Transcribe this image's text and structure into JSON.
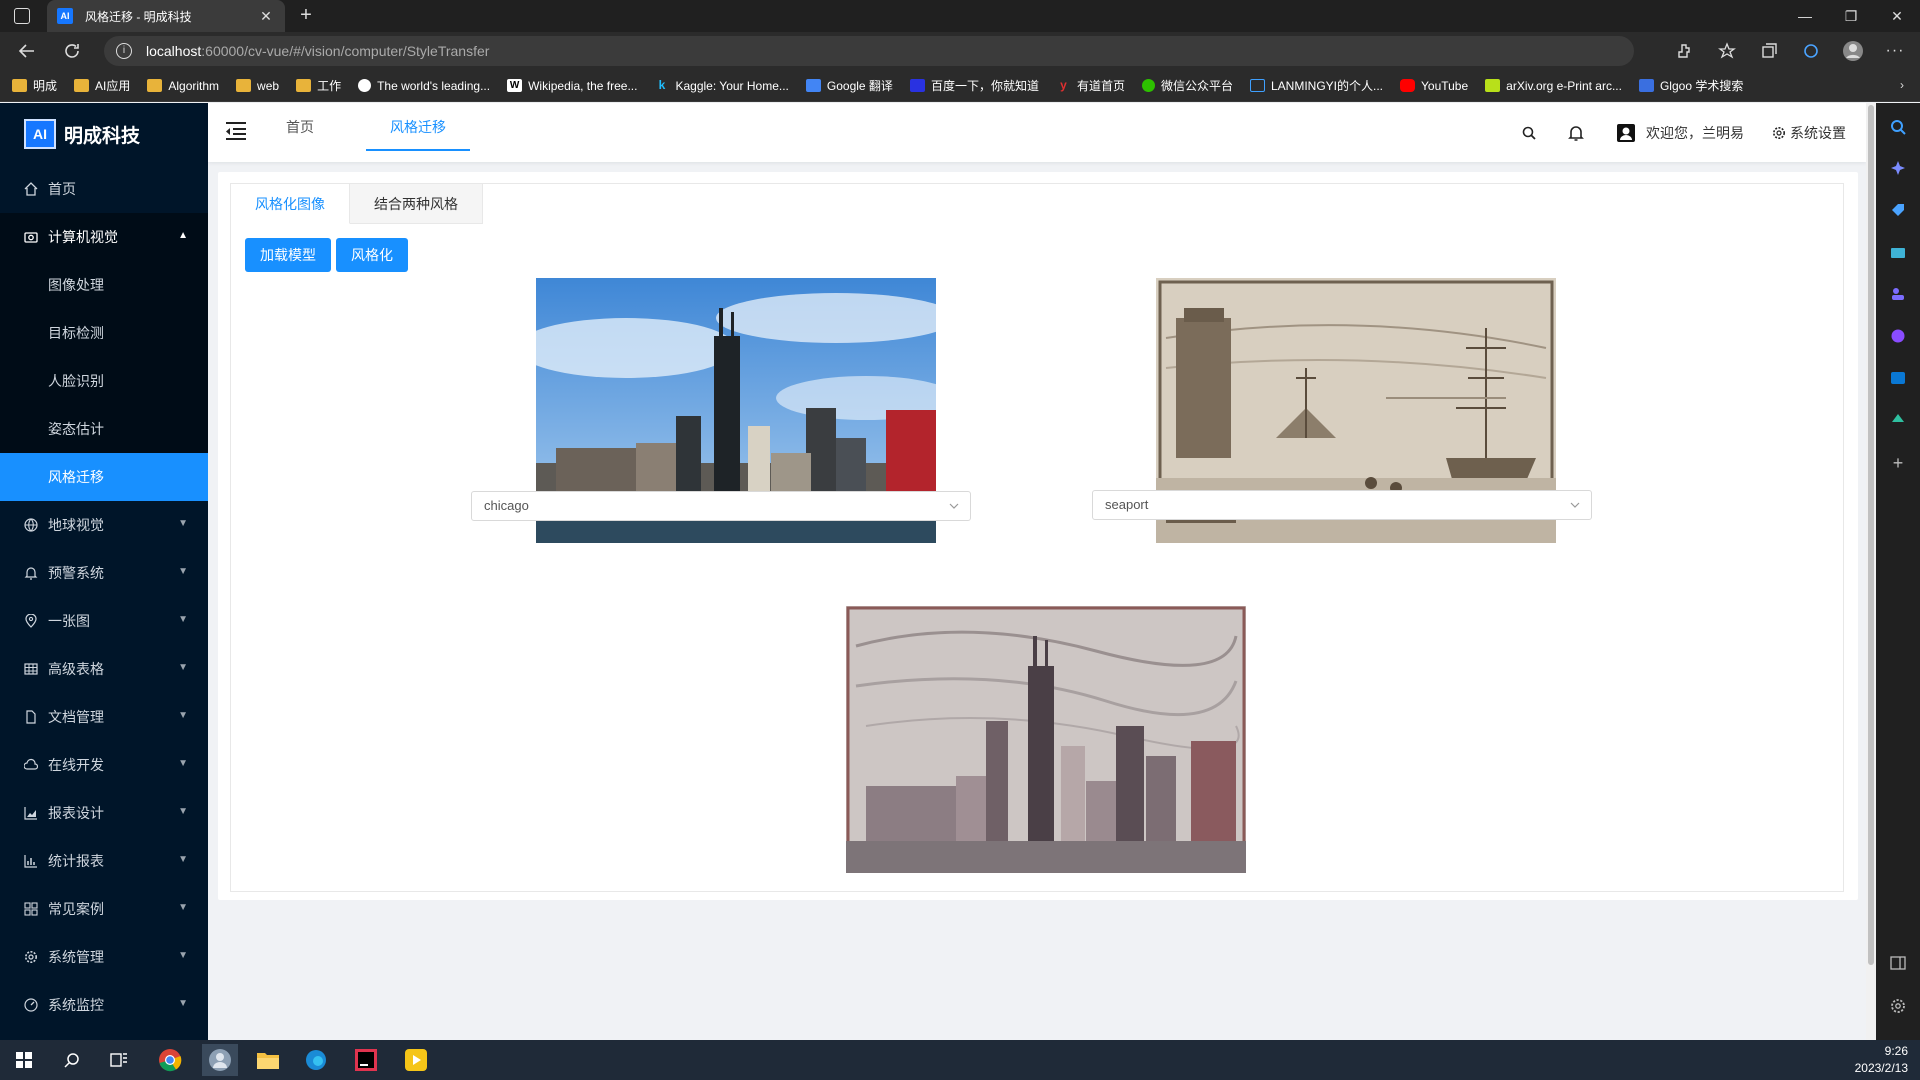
{
  "browser": {
    "tab_title": "风格迁移 - 明成科技",
    "tab_favicon": "AI",
    "url_host": "localhost",
    "url_path": ":60000/cv-vue/#/vision/computer/StyleTransfer",
    "bookmarks": [
      "明成",
      "AI应用",
      "Algorithm",
      "web",
      "工作",
      "The world's leading...",
      "Wikipedia, the free...",
      "Kaggle: Your Home...",
      "Google 翻译",
      "百度一下，你就知道",
      "有道首页",
      "微信公众平台",
      "LANMINGYI的个人...",
      "YouTube",
      "arXiv.org e-Print arc...",
      "Glgoo 学术搜索"
    ]
  },
  "sidebar": {
    "logo_icon": "AI",
    "logo_text": "明成科技",
    "items": [
      {
        "label": "首页",
        "icon": "home-icon"
      },
      {
        "label": "计算机视觉",
        "icon": "camera-icon",
        "expanded": true
      },
      {
        "label": "地球视觉",
        "icon": "globe-icon"
      },
      {
        "label": "预警系统",
        "icon": "bell-icon"
      },
      {
        "label": "一张图",
        "icon": "location-icon"
      },
      {
        "label": "高级表格",
        "icon": "table-icon"
      },
      {
        "label": "文档管理",
        "icon": "file-icon"
      },
      {
        "label": "在线开发",
        "icon": "cloud-icon"
      },
      {
        "label": "报表设计",
        "icon": "area-chart-icon"
      },
      {
        "label": "统计报表",
        "icon": "bar-chart-icon"
      },
      {
        "label": "常见案例",
        "icon": "appstore-icon"
      },
      {
        "label": "系统管理",
        "icon": "setting-icon"
      },
      {
        "label": "系统监控",
        "icon": "dashboard-icon"
      }
    ],
    "submenu": [
      "图像处理",
      "目标检测",
      "人脸识别",
      "姿态估计",
      "风格迁移"
    ],
    "active_sub": "风格迁移"
  },
  "header": {
    "tabs": [
      "首页",
      "风格迁移"
    ],
    "active_tab": "风格迁移",
    "welcome": "欢迎您，兰明易",
    "settings": "系统设置"
  },
  "content": {
    "tabs": [
      "风格化图像",
      "结合两种风格"
    ],
    "active_tab": "风格化图像",
    "load_model_button": "加载模型",
    "stylize_button": "风格化",
    "content_select": "chicago",
    "style_select": "seaport"
  },
  "taskbar": {
    "time": "9:26",
    "date": "2023/2/13"
  },
  "colors": {
    "primary": "#1890ff",
    "sidebar_bg": "#001529",
    "submenu_bg": "#000c17"
  }
}
